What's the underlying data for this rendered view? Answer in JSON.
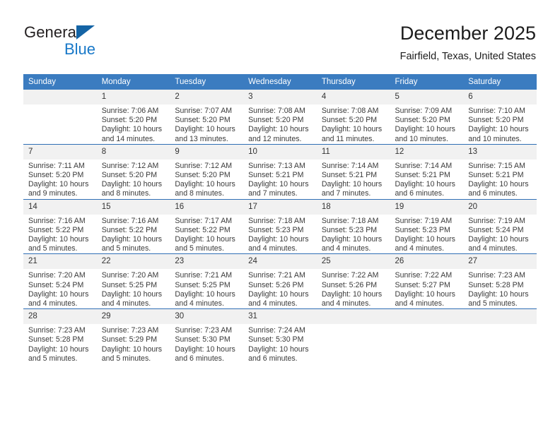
{
  "brand": {
    "name_top": "General",
    "name_bottom": "Blue",
    "triangle_color": "#1464a5",
    "blue_text_color": "#1878c8"
  },
  "header": {
    "title": "December 2025",
    "subtitle": "Fairfield, Texas, United States",
    "accent_color": "#3b7cc0",
    "row_divider_color": "#2f6eb5",
    "daynum_background": "#f1f1f1"
  },
  "calendar": {
    "weekday_headers": [
      "Sunday",
      "Monday",
      "Tuesday",
      "Wednesday",
      "Thursday",
      "Friday",
      "Saturday"
    ],
    "weeks": [
      [
        {
          "day": "",
          "sunrise": "",
          "sunset": "",
          "daylight": ""
        },
        {
          "day": "1",
          "sunrise": "Sunrise: 7:06 AM",
          "sunset": "Sunset: 5:20 PM",
          "daylight": "Daylight: 10 hours and 14 minutes."
        },
        {
          "day": "2",
          "sunrise": "Sunrise: 7:07 AM",
          "sunset": "Sunset: 5:20 PM",
          "daylight": "Daylight: 10 hours and 13 minutes."
        },
        {
          "day": "3",
          "sunrise": "Sunrise: 7:08 AM",
          "sunset": "Sunset: 5:20 PM",
          "daylight": "Daylight: 10 hours and 12 minutes."
        },
        {
          "day": "4",
          "sunrise": "Sunrise: 7:08 AM",
          "sunset": "Sunset: 5:20 PM",
          "daylight": "Daylight: 10 hours and 11 minutes."
        },
        {
          "day": "5",
          "sunrise": "Sunrise: 7:09 AM",
          "sunset": "Sunset: 5:20 PM",
          "daylight": "Daylight: 10 hours and 10 minutes."
        },
        {
          "day": "6",
          "sunrise": "Sunrise: 7:10 AM",
          "sunset": "Sunset: 5:20 PM",
          "daylight": "Daylight: 10 hours and 10 minutes."
        }
      ],
      [
        {
          "day": "7",
          "sunrise": "Sunrise: 7:11 AM",
          "sunset": "Sunset: 5:20 PM",
          "daylight": "Daylight: 10 hours and 9 minutes."
        },
        {
          "day": "8",
          "sunrise": "Sunrise: 7:12 AM",
          "sunset": "Sunset: 5:20 PM",
          "daylight": "Daylight: 10 hours and 8 minutes."
        },
        {
          "day": "9",
          "sunrise": "Sunrise: 7:12 AM",
          "sunset": "Sunset: 5:20 PM",
          "daylight": "Daylight: 10 hours and 8 minutes."
        },
        {
          "day": "10",
          "sunrise": "Sunrise: 7:13 AM",
          "sunset": "Sunset: 5:21 PM",
          "daylight": "Daylight: 10 hours and 7 minutes."
        },
        {
          "day": "11",
          "sunrise": "Sunrise: 7:14 AM",
          "sunset": "Sunset: 5:21 PM",
          "daylight": "Daylight: 10 hours and 7 minutes."
        },
        {
          "day": "12",
          "sunrise": "Sunrise: 7:14 AM",
          "sunset": "Sunset: 5:21 PM",
          "daylight": "Daylight: 10 hours and 6 minutes."
        },
        {
          "day": "13",
          "sunrise": "Sunrise: 7:15 AM",
          "sunset": "Sunset: 5:21 PM",
          "daylight": "Daylight: 10 hours and 6 minutes."
        }
      ],
      [
        {
          "day": "14",
          "sunrise": "Sunrise: 7:16 AM",
          "sunset": "Sunset: 5:22 PM",
          "daylight": "Daylight: 10 hours and 5 minutes."
        },
        {
          "day": "15",
          "sunrise": "Sunrise: 7:16 AM",
          "sunset": "Sunset: 5:22 PM",
          "daylight": "Daylight: 10 hours and 5 minutes."
        },
        {
          "day": "16",
          "sunrise": "Sunrise: 7:17 AM",
          "sunset": "Sunset: 5:22 PM",
          "daylight": "Daylight: 10 hours and 5 minutes."
        },
        {
          "day": "17",
          "sunrise": "Sunrise: 7:18 AM",
          "sunset": "Sunset: 5:23 PM",
          "daylight": "Daylight: 10 hours and 4 minutes."
        },
        {
          "day": "18",
          "sunrise": "Sunrise: 7:18 AM",
          "sunset": "Sunset: 5:23 PM",
          "daylight": "Daylight: 10 hours and 4 minutes."
        },
        {
          "day": "19",
          "sunrise": "Sunrise: 7:19 AM",
          "sunset": "Sunset: 5:23 PM",
          "daylight": "Daylight: 10 hours and 4 minutes."
        },
        {
          "day": "20",
          "sunrise": "Sunrise: 7:19 AM",
          "sunset": "Sunset: 5:24 PM",
          "daylight": "Daylight: 10 hours and 4 minutes."
        }
      ],
      [
        {
          "day": "21",
          "sunrise": "Sunrise: 7:20 AM",
          "sunset": "Sunset: 5:24 PM",
          "daylight": "Daylight: 10 hours and 4 minutes."
        },
        {
          "day": "22",
          "sunrise": "Sunrise: 7:20 AM",
          "sunset": "Sunset: 5:25 PM",
          "daylight": "Daylight: 10 hours and 4 minutes."
        },
        {
          "day": "23",
          "sunrise": "Sunrise: 7:21 AM",
          "sunset": "Sunset: 5:25 PM",
          "daylight": "Daylight: 10 hours and 4 minutes."
        },
        {
          "day": "24",
          "sunrise": "Sunrise: 7:21 AM",
          "sunset": "Sunset: 5:26 PM",
          "daylight": "Daylight: 10 hours and 4 minutes."
        },
        {
          "day": "25",
          "sunrise": "Sunrise: 7:22 AM",
          "sunset": "Sunset: 5:26 PM",
          "daylight": "Daylight: 10 hours and 4 minutes."
        },
        {
          "day": "26",
          "sunrise": "Sunrise: 7:22 AM",
          "sunset": "Sunset: 5:27 PM",
          "daylight": "Daylight: 10 hours and 4 minutes."
        },
        {
          "day": "27",
          "sunrise": "Sunrise: 7:23 AM",
          "sunset": "Sunset: 5:28 PM",
          "daylight": "Daylight: 10 hours and 5 minutes."
        }
      ],
      [
        {
          "day": "28",
          "sunrise": "Sunrise: 7:23 AM",
          "sunset": "Sunset: 5:28 PM",
          "daylight": "Daylight: 10 hours and 5 minutes."
        },
        {
          "day": "29",
          "sunrise": "Sunrise: 7:23 AM",
          "sunset": "Sunset: 5:29 PM",
          "daylight": "Daylight: 10 hours and 5 minutes."
        },
        {
          "day": "30",
          "sunrise": "Sunrise: 7:23 AM",
          "sunset": "Sunset: 5:30 PM",
          "daylight": "Daylight: 10 hours and 6 minutes."
        },
        {
          "day": "31",
          "sunrise": "Sunrise: 7:24 AM",
          "sunset": "Sunset: 5:30 PM",
          "daylight": "Daylight: 10 hours and 6 minutes."
        },
        {
          "day": "",
          "sunrise": "",
          "sunset": "",
          "daylight": ""
        },
        {
          "day": "",
          "sunrise": "",
          "sunset": "",
          "daylight": ""
        },
        {
          "day": "",
          "sunrise": "",
          "sunset": "",
          "daylight": ""
        }
      ]
    ]
  }
}
